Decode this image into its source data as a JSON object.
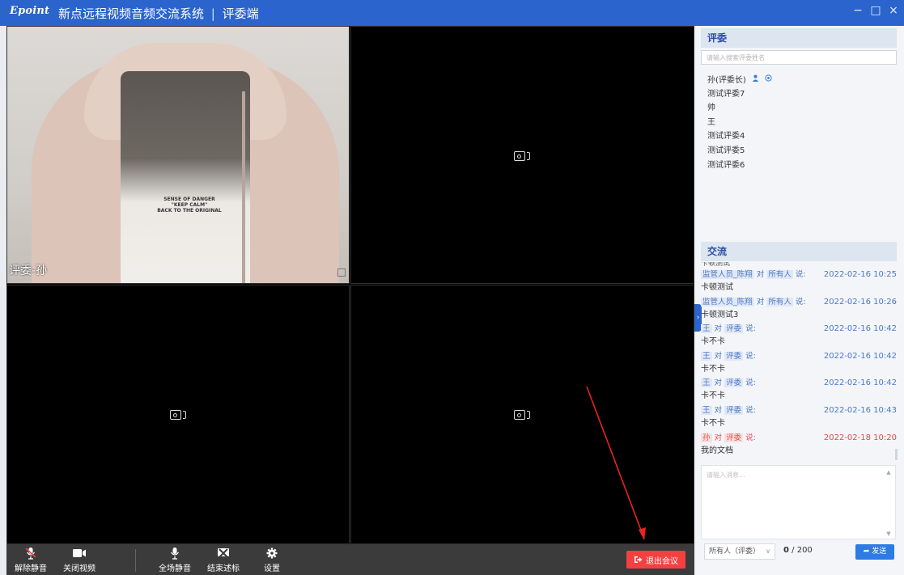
{
  "titlebar": {
    "logo": "Epoint",
    "title": "新点远程视频音频交流系统",
    "separator": "|",
    "subtitle": "评委端",
    "minimize": "−",
    "maximize": "□",
    "close": "×"
  },
  "video": {
    "main_tile_label": "评委-孙",
    "shirt_text": "SENSE OF DANGER\n\"KEEP CALM\"\nBACK TO THE ORIGINAL"
  },
  "toolbar": {
    "unmute_label": "解除静音",
    "video_off_label": "关闭视频",
    "mute_all_label": "全场静音",
    "end_share_label": "结束述标",
    "settings_label": "设置",
    "exit_label": "退出会议"
  },
  "judges": {
    "title": "评委",
    "search_placeholder": "请输入搜索评委姓名",
    "members": [
      "孙(评委长)",
      "测试评委7",
      "帅",
      "王",
      "测试评委4",
      "测试评委5",
      "测试评委6"
    ]
  },
  "chat": {
    "title": "交流",
    "cut_text": "卡顿测试",
    "messages": [
      {
        "sender": "监管人员_陈翔",
        "target": "所有人",
        "time": "2022-02-16 10:25",
        "body": "卡顿测试",
        "red": false
      },
      {
        "sender": "监管人员_陈翔",
        "target": "所有人",
        "time": "2022-02-16 10:26",
        "body": "卡顿测试3",
        "red": false
      },
      {
        "sender": "王",
        "target": "评委",
        "time": "2022-02-16 10:42",
        "body": "卡不卡",
        "red": false
      },
      {
        "sender": "王",
        "target": "评委",
        "time": "2022-02-16 10:42",
        "body": "卡不卡",
        "red": false
      },
      {
        "sender": "王",
        "target": "评委",
        "time": "2022-02-16 10:42",
        "body": "卡不卡",
        "red": false
      },
      {
        "sender": "王",
        "target": "评委",
        "time": "2022-02-16 10:43",
        "body": "卡不卡",
        "red": false
      },
      {
        "sender": "孙",
        "target": "评委",
        "time": "2022-02-18 10:20",
        "body": "我的文档",
        "red": true
      }
    ],
    "input_placeholder": "请输入消息...",
    "recipient": "所有人（评委）",
    "count": "0",
    "max": "/ 200",
    "send_label": "发送"
  },
  "colors": {
    "titlebar": "#2a64cc",
    "exit_button": "#f54040",
    "send_button": "#2d7be5",
    "chat_blue": "#4a78c8",
    "chat_red": "#e05555",
    "annotation_arrow": "#e8231f"
  }
}
